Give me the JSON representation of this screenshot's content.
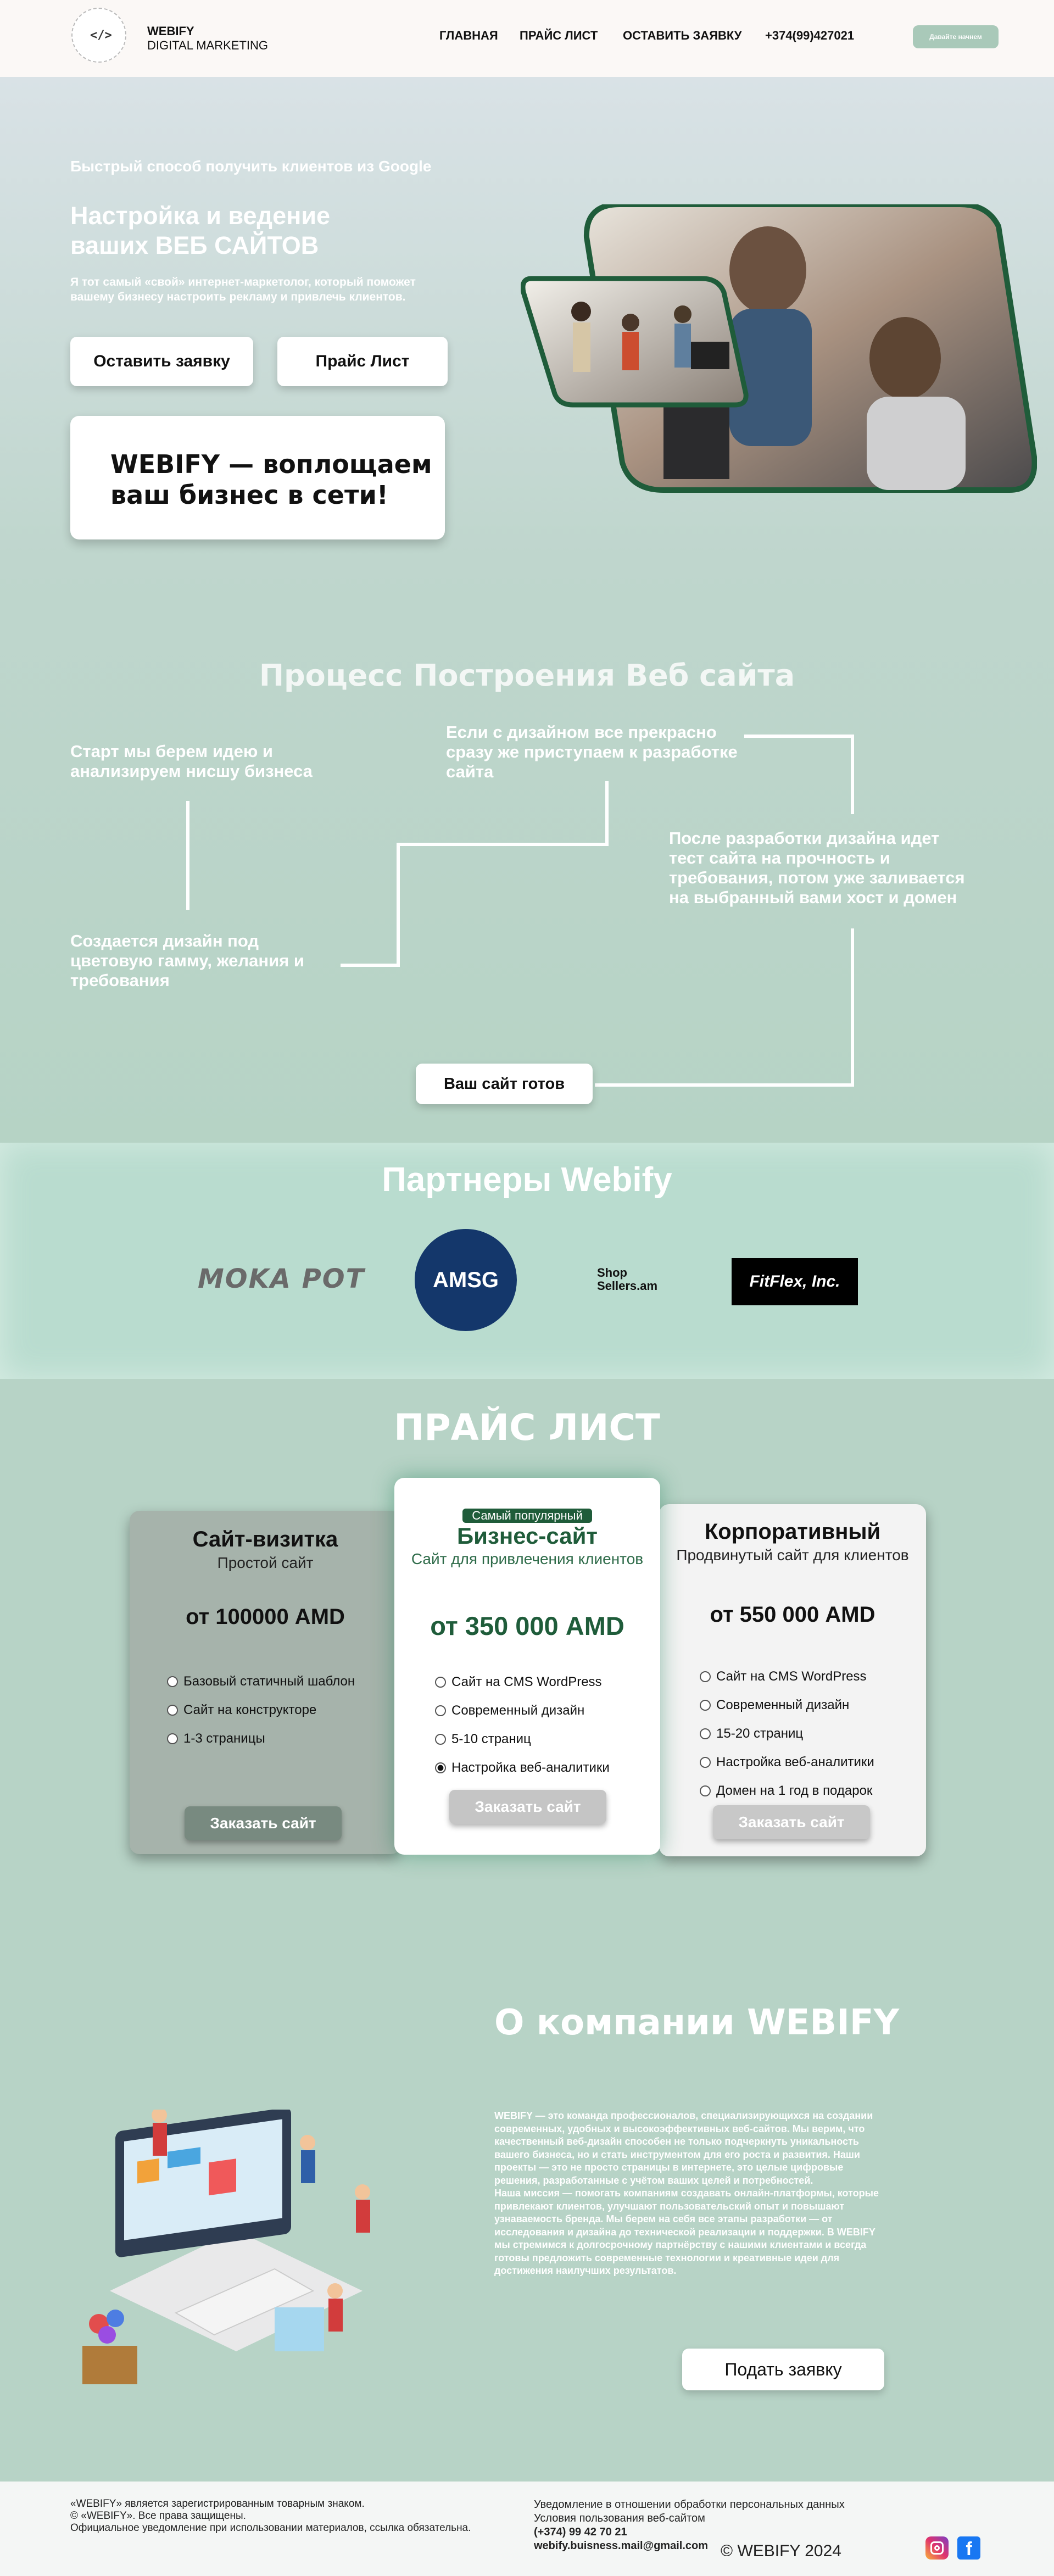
{
  "header": {
    "brand_line1": "WEBIFY",
    "brand_line2": "DIGITAL MARKETING",
    "nav": [
      "ГЛАВНАЯ",
      "ПРАЙС ЛИСТ",
      "ОСТАВИТЬ ЗАЯВКУ",
      "+374(99)427021"
    ],
    "cta": "Давайте начнем"
  },
  "hero": {
    "kicker": "Быстрый способ получить клиентов из Google",
    "title_line1": "Настройка и ведение",
    "title_line2": "ваших ВЕБ САЙТОВ",
    "subtitle_line1": "Я тот самый «свой» интернет-маркетолог, который поможет",
    "subtitle_line2": "вашему бизнесу настроить рекламу и привлечь клиентов.",
    "btn_request": "Оставить заявку",
    "btn_price": "Прайс Лист",
    "tagline_line1": "WEBIFY — воплощаем",
    "tagline_line2": "ваш бизнес в сети!"
  },
  "process": {
    "title": "Процесс Построения Веб сайта",
    "step1": [
      "Старт мы берем идею и",
      "анализируем нисшу бизнеса"
    ],
    "step2": [
      "Создается дизайн под",
      "цветовую гамму, желания и",
      "требования"
    ],
    "step3": [
      "Если с дизайном все прекрасно",
      "сразу же приступаем к разработке",
      "сайта"
    ],
    "step4": [
      "После разработки дизайна идет",
      "тест сайта на прочность и",
      "требования, потом уже заливается",
      "на выбранный вами хост и домен"
    ],
    "final": "Ваш сайт готов"
  },
  "partners": {
    "title": "Партнеры Webify",
    "logos": [
      "MOKA POT",
      "AMSG",
      "Shop Sellers.am",
      "FitFlex, Inc."
    ]
  },
  "pricing": {
    "title": "ПРАЙС ЛИСТ",
    "plans": [
      {
        "name": "Сайт-визитка",
        "sub": "Простой сайт",
        "price": "от 100000 AMD",
        "badge": "",
        "options": [
          "Базовый статичный шаблон",
          "Сайт на конструкторе",
          "1-3 страницы"
        ],
        "button": "Заказать сайт"
      },
      {
        "name": "Бизнес-сайт",
        "sub": "Сайт для привлечения клиентов",
        "price": "от 350 000 AMD",
        "badge": "Самый популярный",
        "options": [
          "Сайт на CMS WordPress",
          "Современный дизайн",
          "5-10 страниц",
          "Настройка веб-аналитики"
        ],
        "button": "Заказать сайт"
      },
      {
        "name": "Корпоративный",
        "sub": "Продвинутый сайт для клиентов",
        "price": "от 550 000 AMD",
        "badge": "",
        "options": [
          "Сайт на CMS WordPress",
          "Современный дизайн",
          "15-20 страниц",
          "Настройка веб-аналитики",
          "Домен на 1 год в подарок"
        ],
        "button": "Заказать сайт"
      }
    ],
    "colors": {
      "basic": "#a6b3ab",
      "popular": "#ffffff",
      "corporate": "#f3f3f3",
      "accent": "#1f5c3a"
    }
  },
  "about": {
    "title": "О компании WEBIFY",
    "lines": [
      "WEBIFY — это команда профессионалов, специализирующихся на создании",
      "современных, удобных и высокоэффективных веб-сайтов. Мы верим, что",
      "качественный веб-дизайн способен не только подчеркнуть уникальность",
      "вашего бизнеса, но и стать инструментом для его роста и развития. Наши",
      "проекты — это не просто страницы в интернете, это целые цифровые",
      "решения, разработанные с учётом ваших целей и потребностей.",
      "Наша миссия — помогать компаниям создавать онлайн-платформы, которые",
      "привлекают клиентов, улучшают пользовательский опыт и повышают",
      "узнаваемость бренда. Мы берем на себя все этапы разработки — от",
      "исследования и дизайна до технической реализации и поддержки. В WEBIFY",
      "мы стремимся к долгосрочному партнёрству с нашими клиентами и всегда",
      "готовы предложить современные технологии и креативные идеи для",
      "достижения наилучших результатов."
    ],
    "button": "Подать заявку"
  },
  "footer": {
    "left": [
      "«WEBIFY» является зарегистрированным товарным знаком.",
      "© «WEBIFY». Все права защищены.",
      "Официальное уведомление при использовании материалов, ссылка обязательна."
    ],
    "right": [
      "Уведомление в отношении обработки персональных данных",
      "Условия пользования веб-сайтом",
      "(+374) 99 42 70 21",
      "webify.buisness.mail@gmail.com"
    ],
    "copyright": "© WEBIFY 2024"
  }
}
